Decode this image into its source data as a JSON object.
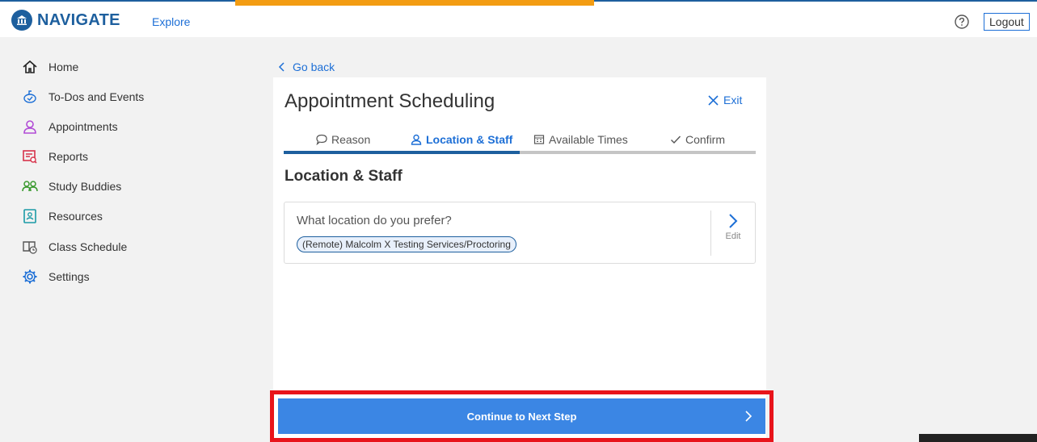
{
  "header": {
    "brand": "NAVIGATE",
    "explore_label": "Explore",
    "logout_label": "Logout",
    "progress_color": "#f39c12"
  },
  "sidebar": {
    "items": [
      {
        "label": "Home",
        "icon": "home-icon"
      },
      {
        "label": "To-Dos and Events",
        "icon": "todo-icon"
      },
      {
        "label": "Appointments",
        "icon": "person-icon"
      },
      {
        "label": "Reports",
        "icon": "report-icon"
      },
      {
        "label": "Study Buddies",
        "icon": "study-buddies-icon"
      },
      {
        "label": "Resources",
        "icon": "resources-icon"
      },
      {
        "label": "Class Schedule",
        "icon": "class-schedule-icon"
      },
      {
        "label": "Settings",
        "icon": "gear-icon"
      }
    ]
  },
  "main": {
    "go_back_label": "Go back",
    "title": "Appointment Scheduling",
    "exit_label": "Exit",
    "tabs": [
      {
        "label": "Reason",
        "icon": "speech-bubble-icon",
        "active": false
      },
      {
        "label": "Location & Staff",
        "icon": "person-icon",
        "active": true
      },
      {
        "label": "Available Times",
        "icon": "calendar-icon",
        "active": false
      },
      {
        "label": "Confirm",
        "icon": "checkmark-icon",
        "active": false
      }
    ],
    "section_title": "Location & Staff",
    "location_card": {
      "question": "What location do you prefer?",
      "selected": "(Remote) Malcolm X Testing Services/Proctoring",
      "edit_label": "Edit"
    },
    "continue_label": "Continue to Next Step"
  },
  "colors": {
    "brand": "#1d5f9e",
    "link": "#1d6fd6",
    "primary_button": "#3b86e4",
    "highlight": "#e8141b"
  }
}
